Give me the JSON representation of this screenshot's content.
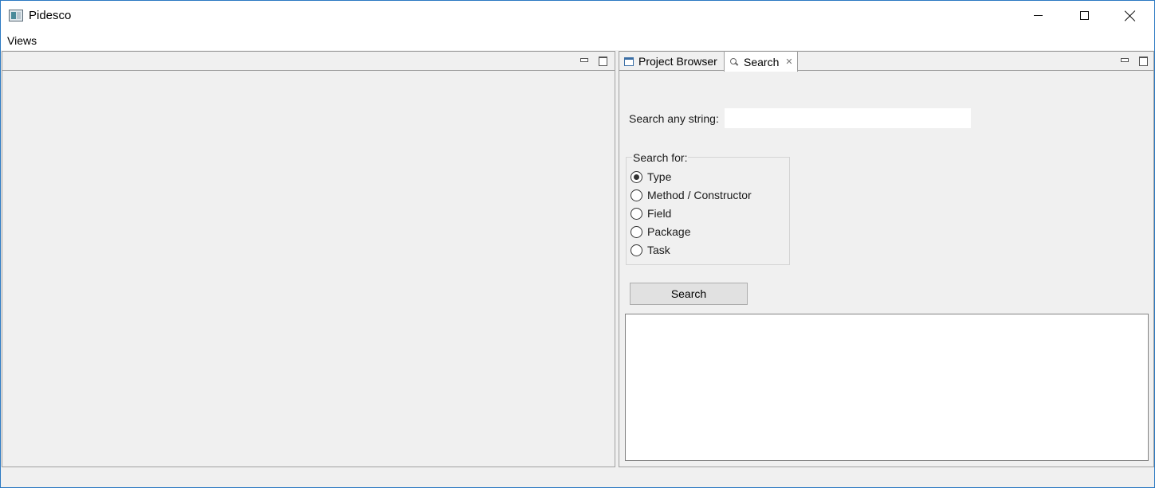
{
  "window": {
    "title": "Pidesco"
  },
  "menubar": {
    "items": [
      {
        "label": "Views"
      }
    ]
  },
  "right_pane": {
    "tabs": [
      {
        "label": "Project Browser",
        "icon": "window-icon",
        "active": false
      },
      {
        "label": "Search",
        "icon": "search-icon",
        "active": true,
        "closable": true
      }
    ]
  },
  "search": {
    "field_label": "Search any string:",
    "field_value": "",
    "group_title": "Search for:",
    "options": [
      {
        "label": "Type",
        "checked": true
      },
      {
        "label": "Method / Constructor",
        "checked": false
      },
      {
        "label": "Field",
        "checked": false
      },
      {
        "label": "Package",
        "checked": false
      },
      {
        "label": "Task",
        "checked": false
      }
    ],
    "button_label": "Search"
  }
}
